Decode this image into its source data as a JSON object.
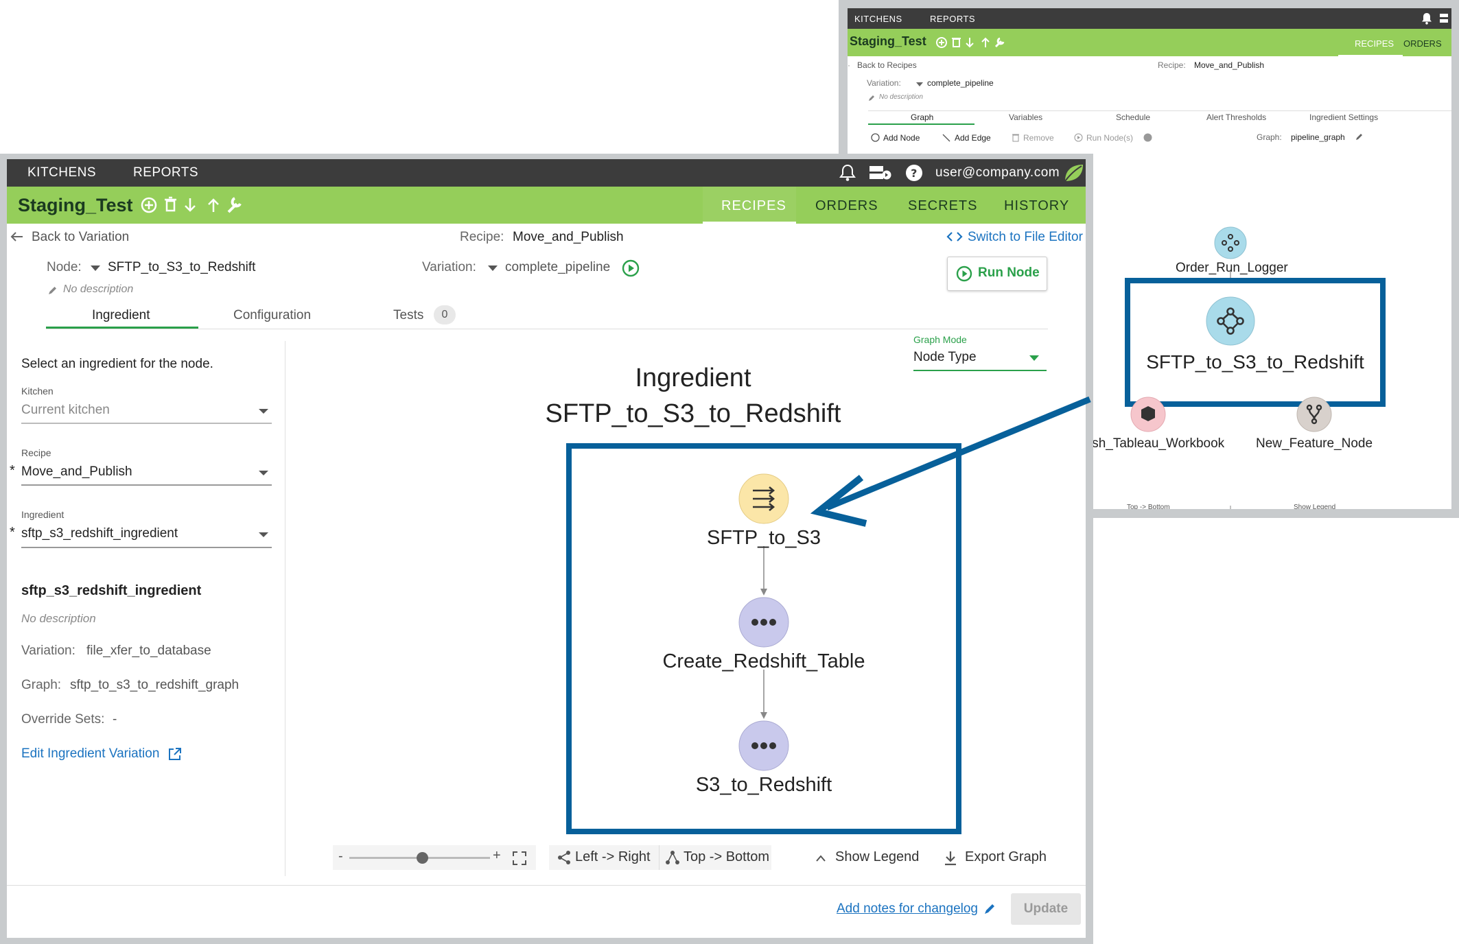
{
  "back_window": {
    "topbar": {
      "kitchens": "KITCHENS",
      "reports": "REPORTS"
    },
    "header": {
      "title": "Staging_Test",
      "tabs": [
        "RECIPES",
        "ORDERS"
      ]
    },
    "back_link": "Back to Recipes",
    "recipe_label": "Recipe:",
    "recipe_value": "Move_and_Publish",
    "variation_label": "Variation:",
    "variation_value": "complete_pipeline",
    "no_description": "No description",
    "subtabs": [
      "Graph",
      "Variables",
      "Schedule",
      "Alert Thresholds",
      "Ingredient Settings"
    ],
    "toolbar": {
      "add_node": "Add Node",
      "add_edge": "Add Edge",
      "remove": "Remove",
      "run_nodes": "Run Node(s)",
      "graph_label": "Graph:",
      "graph_value": "pipeline_graph"
    },
    "graph_nodes": [
      "Order_Run_Logger",
      "SFTP_to_S3_to_Redshift",
      "ish_Tableau_Workbook",
      "New_Feature_Node"
    ],
    "footer": {
      "top_bottom": "Top -> Bottom",
      "show_legend": "Show Legend"
    }
  },
  "front_window": {
    "topbar": {
      "kitchens": "KITCHENS",
      "reports": "REPORTS",
      "user": "user@company.com"
    },
    "header": {
      "title": "Staging_Test",
      "tabs": [
        "RECIPES",
        "ORDERS",
        "SECRETS",
        "HISTORY"
      ],
      "active_tab": "RECIPES"
    },
    "back_link": "Back to Variation",
    "recipe_label": "Recipe:",
    "recipe_value": "Move_and_Publish",
    "switch_editor": "Switch to File Editor",
    "node_label": "Node:",
    "node_value": "SFTP_to_S3_to_Redshift",
    "variation_label": "Variation:",
    "variation_value": "complete_pipeline",
    "run_node": "Run Node",
    "no_description": "No description",
    "tabs": {
      "ingredient": "Ingredient",
      "configuration": "Configuration",
      "tests": "Tests",
      "tests_count": "0"
    },
    "left_panel": {
      "prompt": "Select an ingredient for the node.",
      "kitchen_label": "Kitchen",
      "kitchen_value": "Current kitchen",
      "recipe_label": "Recipe",
      "recipe_value": "Move_and_Publish",
      "ingredient_label": "Ingredient",
      "ingredient_value": "sftp_s3_redshift_ingredient",
      "required_mark": "*",
      "info_title": "sftp_s3_redshift_ingredient",
      "info_desc": "No description",
      "variation_label": "Variation:",
      "variation_value": "file_xfer_to_database",
      "graph_label": "Graph:",
      "graph_value": "sftp_to_s3_to_redshift_graph",
      "override_label": "Override Sets:",
      "override_value": "-",
      "edit_link": "Edit Ingredient Variation"
    },
    "graph": {
      "mode_label": "Graph Mode",
      "mode_value": "Node Type",
      "title_line1": "Ingredient",
      "title_line2": "SFTP_to_S3_to_Redshift",
      "nodes": [
        "SFTP_to_S3",
        "Create_Redshift_Table",
        "S3_to_Redshift"
      ]
    },
    "toolbar": {
      "minus": "-",
      "plus": "+",
      "zoom_fraction": 0.52,
      "left_right": "Left -> Right",
      "top_bottom": "Top -> Bottom",
      "show_legend": "Show Legend",
      "export": "Export Graph"
    },
    "footer": {
      "notes_link": "Add notes for changelog",
      "update": "Update"
    }
  },
  "colors": {
    "brand_green": "#95ce5a",
    "topbar": "#3c3c3c",
    "highlight_blue": "#07609a",
    "link_blue": "#1b73c0",
    "run_green": "#2aa04a"
  }
}
